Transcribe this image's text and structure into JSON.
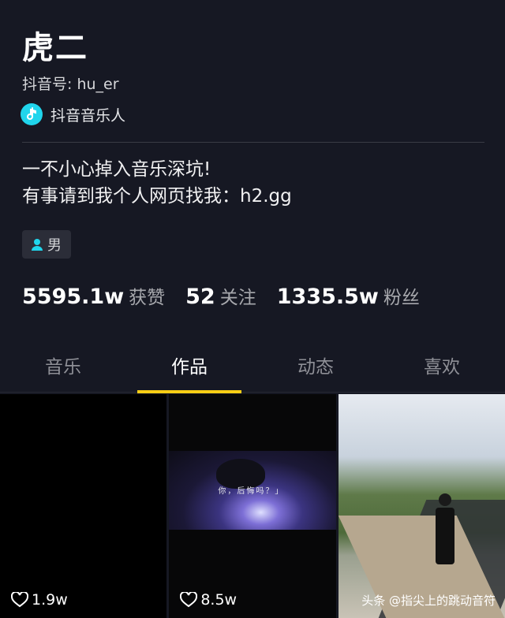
{
  "profile": {
    "name": "虎二",
    "douyin_id": "抖音号: hu_er",
    "musician_label": "抖音音乐人",
    "bio_line1": "一不小心掉入音乐深坑!",
    "bio_line2": "有事请到我个人网页找我：h2.gg",
    "gender": "男"
  },
  "stats": [
    {
      "value": "5595.1w",
      "label": "获赞"
    },
    {
      "value": "52",
      "label": "关注"
    },
    {
      "value": "1335.5w",
      "label": "粉丝"
    }
  ],
  "tabs": [
    {
      "label": "音乐",
      "active": false
    },
    {
      "label": "作品",
      "active": true
    },
    {
      "label": "动态",
      "active": false
    },
    {
      "label": "喜欢",
      "active": false
    }
  ],
  "videos": [
    {
      "likes": "1.9w",
      "caption": ""
    },
    {
      "likes": "8.5w",
      "caption": "你，后悔吗？」"
    },
    {
      "likes": "",
      "watermark": "头条 @指尖上的跳动音符"
    }
  ],
  "colors": {
    "background": "#161823",
    "accent": "#face15",
    "musician_badge": "#20d5ec"
  }
}
